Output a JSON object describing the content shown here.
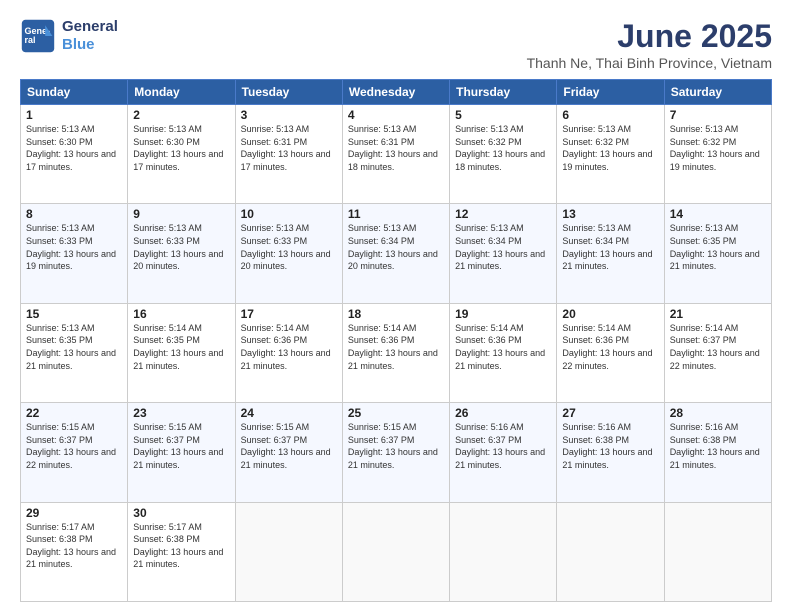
{
  "logo": {
    "line1": "General",
    "line2": "Blue"
  },
  "title": "June 2025",
  "subtitle": "Thanh Ne, Thai Binh Province, Vietnam",
  "days_header": [
    "Sunday",
    "Monday",
    "Tuesday",
    "Wednesday",
    "Thursday",
    "Friday",
    "Saturday"
  ],
  "weeks": [
    [
      {
        "day": "1",
        "rise": "5:13 AM",
        "set": "6:30 PM",
        "hours": "13 hours and 17 minutes."
      },
      {
        "day": "2",
        "rise": "5:13 AM",
        "set": "6:30 PM",
        "hours": "13 hours and 17 minutes."
      },
      {
        "day": "3",
        "rise": "5:13 AM",
        "set": "6:31 PM",
        "hours": "13 hours and 17 minutes."
      },
      {
        "day": "4",
        "rise": "5:13 AM",
        "set": "6:31 PM",
        "hours": "13 hours and 18 minutes."
      },
      {
        "day": "5",
        "rise": "5:13 AM",
        "set": "6:32 PM",
        "hours": "13 hours and 18 minutes."
      },
      {
        "day": "6",
        "rise": "5:13 AM",
        "set": "6:32 PM",
        "hours": "13 hours and 19 minutes."
      },
      {
        "day": "7",
        "rise": "5:13 AM",
        "set": "6:32 PM",
        "hours": "13 hours and 19 minutes."
      }
    ],
    [
      {
        "day": "8",
        "rise": "5:13 AM",
        "set": "6:33 PM",
        "hours": "13 hours and 19 minutes."
      },
      {
        "day": "9",
        "rise": "5:13 AM",
        "set": "6:33 PM",
        "hours": "13 hours and 20 minutes."
      },
      {
        "day": "10",
        "rise": "5:13 AM",
        "set": "6:33 PM",
        "hours": "13 hours and 20 minutes."
      },
      {
        "day": "11",
        "rise": "5:13 AM",
        "set": "6:34 PM",
        "hours": "13 hours and 20 minutes."
      },
      {
        "day": "12",
        "rise": "5:13 AM",
        "set": "6:34 PM",
        "hours": "13 hours and 21 minutes."
      },
      {
        "day": "13",
        "rise": "5:13 AM",
        "set": "6:34 PM",
        "hours": "13 hours and 21 minutes."
      },
      {
        "day": "14",
        "rise": "5:13 AM",
        "set": "6:35 PM",
        "hours": "13 hours and 21 minutes."
      }
    ],
    [
      {
        "day": "15",
        "rise": "5:13 AM",
        "set": "6:35 PM",
        "hours": "13 hours and 21 minutes."
      },
      {
        "day": "16",
        "rise": "5:14 AM",
        "set": "6:35 PM",
        "hours": "13 hours and 21 minutes."
      },
      {
        "day": "17",
        "rise": "5:14 AM",
        "set": "6:36 PM",
        "hours": "13 hours and 21 minutes."
      },
      {
        "day": "18",
        "rise": "5:14 AM",
        "set": "6:36 PM",
        "hours": "13 hours and 21 minutes."
      },
      {
        "day": "19",
        "rise": "5:14 AM",
        "set": "6:36 PM",
        "hours": "13 hours and 21 minutes."
      },
      {
        "day": "20",
        "rise": "5:14 AM",
        "set": "6:36 PM",
        "hours": "13 hours and 22 minutes."
      },
      {
        "day": "21",
        "rise": "5:14 AM",
        "set": "6:37 PM",
        "hours": "13 hours and 22 minutes."
      }
    ],
    [
      {
        "day": "22",
        "rise": "5:15 AM",
        "set": "6:37 PM",
        "hours": "13 hours and 22 minutes."
      },
      {
        "day": "23",
        "rise": "5:15 AM",
        "set": "6:37 PM",
        "hours": "13 hours and 21 minutes."
      },
      {
        "day": "24",
        "rise": "5:15 AM",
        "set": "6:37 PM",
        "hours": "13 hours and 21 minutes."
      },
      {
        "day": "25",
        "rise": "5:15 AM",
        "set": "6:37 PM",
        "hours": "13 hours and 21 minutes."
      },
      {
        "day": "26",
        "rise": "5:16 AM",
        "set": "6:37 PM",
        "hours": "13 hours and 21 minutes."
      },
      {
        "day": "27",
        "rise": "5:16 AM",
        "set": "6:38 PM",
        "hours": "13 hours and 21 minutes."
      },
      {
        "day": "28",
        "rise": "5:16 AM",
        "set": "6:38 PM",
        "hours": "13 hours and 21 minutes."
      }
    ],
    [
      {
        "day": "29",
        "rise": "5:17 AM",
        "set": "6:38 PM",
        "hours": "13 hours and 21 minutes."
      },
      {
        "day": "30",
        "rise": "5:17 AM",
        "set": "6:38 PM",
        "hours": "13 hours and 21 minutes."
      },
      null,
      null,
      null,
      null,
      null
    ]
  ],
  "labels": {
    "sunrise": "Sunrise:",
    "sunset": "Sunset:",
    "daylight": "Daylight:"
  }
}
